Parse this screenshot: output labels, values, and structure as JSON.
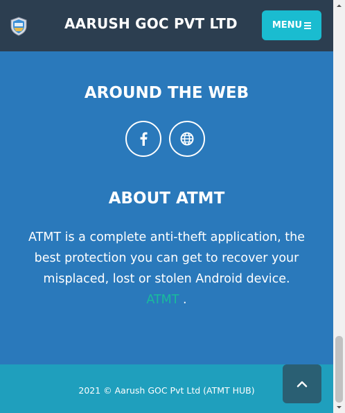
{
  "navbar": {
    "brand": "AARUSH GOC PVT LTD",
    "menu_label": "MENU",
    "logo_icon": "shield-logo-icon"
  },
  "footer": {
    "around_title": "AROUND THE WEB",
    "social": [
      {
        "icon": "facebook-icon"
      },
      {
        "icon": "globe-icon"
      }
    ],
    "about_title": "ABOUT ATMT",
    "about_text": "ATMT is a complete anti-theft application, the best protection you can get to recover your misplaced, lost or stolen Android device.",
    "about_link": "ATMT",
    "about_suffix": " ."
  },
  "copyright": {
    "text": "2021  ©  Aarush GOC Pvt Ltd (ATMT HUB)"
  },
  "scroll_top": {
    "icon": "chevron-up-icon"
  },
  "colors": {
    "navbar_bg": "#2c3e50",
    "footer_bg": "#2a79bb",
    "accent": "#1abcd0",
    "link": "#18bc9c",
    "copyright_bg": "#1f9fbd"
  }
}
